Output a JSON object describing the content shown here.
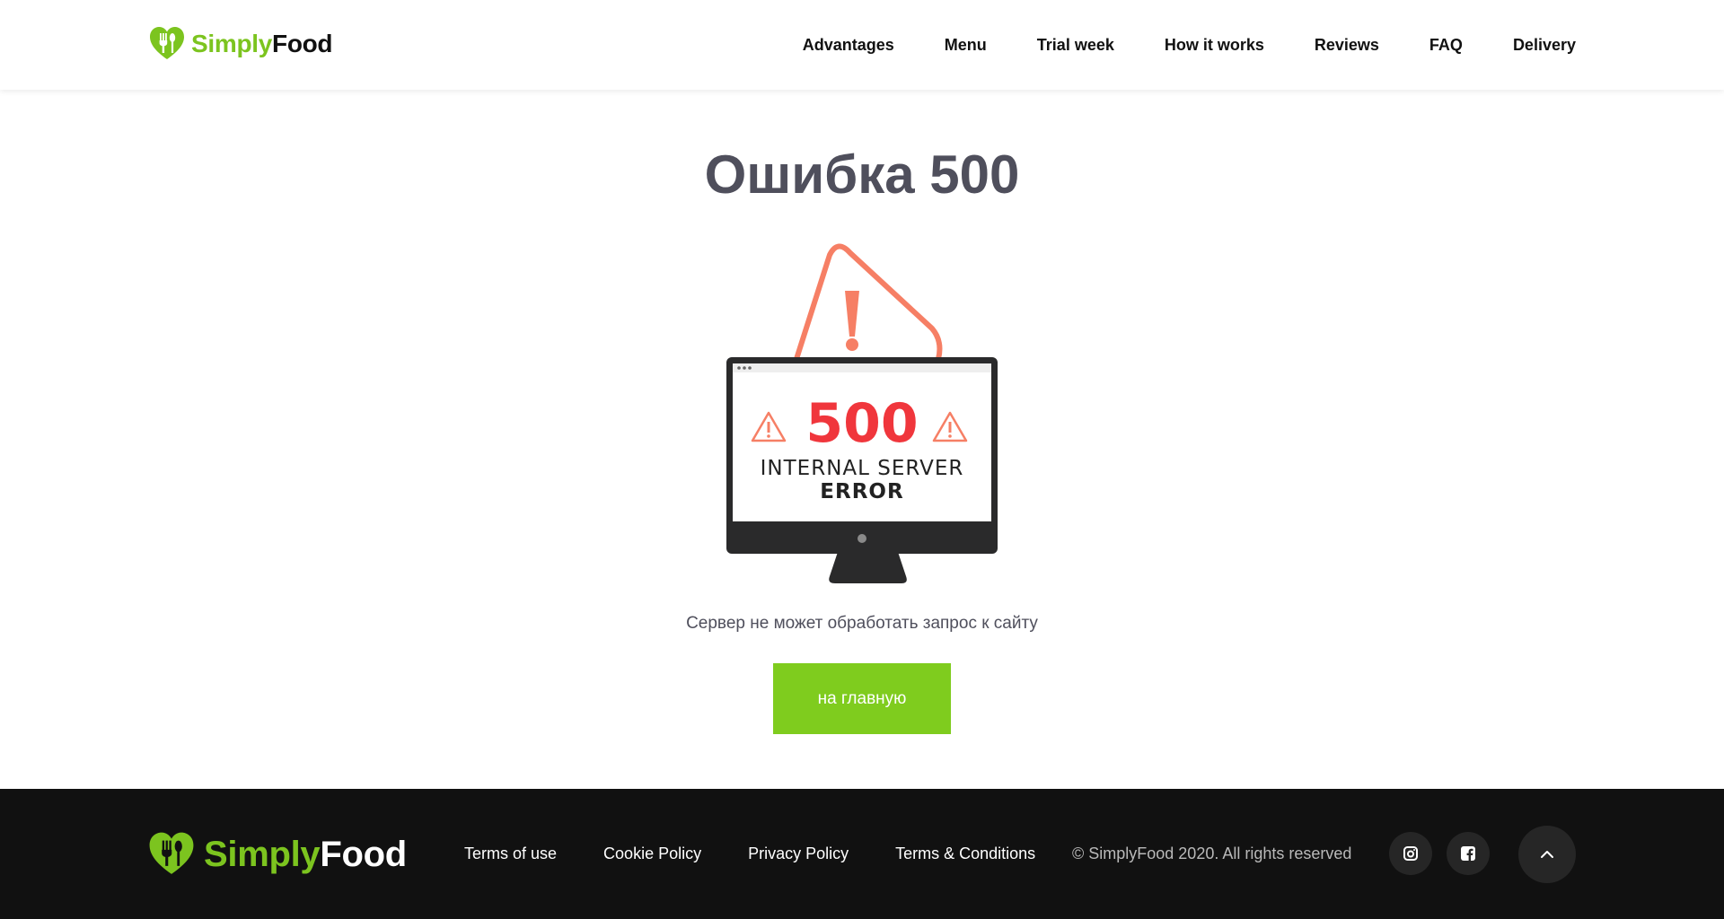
{
  "brand": {
    "name_part1": "Simply",
    "name_part2": "Food",
    "accent_color": "#7cc41f",
    "logo_icon": "heart-fork-spoon-icon"
  },
  "nav": {
    "items": [
      {
        "label": "Advantages"
      },
      {
        "label": "Menu"
      },
      {
        "label": "Trial week"
      },
      {
        "label": "How it works"
      },
      {
        "label": "Reviews"
      },
      {
        "label": "FAQ"
      },
      {
        "label": "Delivery"
      }
    ]
  },
  "error_page": {
    "title": "Ошибка 500",
    "illustration": {
      "code": "500",
      "line1": "INTERNAL SERVER",
      "line2": "ERROR",
      "icon": "warning-triangle-icon",
      "code_color": "#f0363c",
      "warning_color": "#f67f65"
    },
    "message": "Сервер не может обработать запрос к сайту",
    "button_label": "на главную",
    "button_color": "#7fcc1e"
  },
  "footer": {
    "links": [
      {
        "label": "Terms of use"
      },
      {
        "label": "Cookie Policy"
      },
      {
        "label": "Privacy Policy"
      },
      {
        "label": "Terms & Conditions"
      }
    ],
    "copyright": "© SimplyFood 2020. All rights reserved",
    "social": [
      {
        "icon": "instagram-icon"
      },
      {
        "icon": "facebook-icon"
      }
    ],
    "scroll_top_icon": "chevron-up-icon",
    "background_color": "#111111"
  }
}
